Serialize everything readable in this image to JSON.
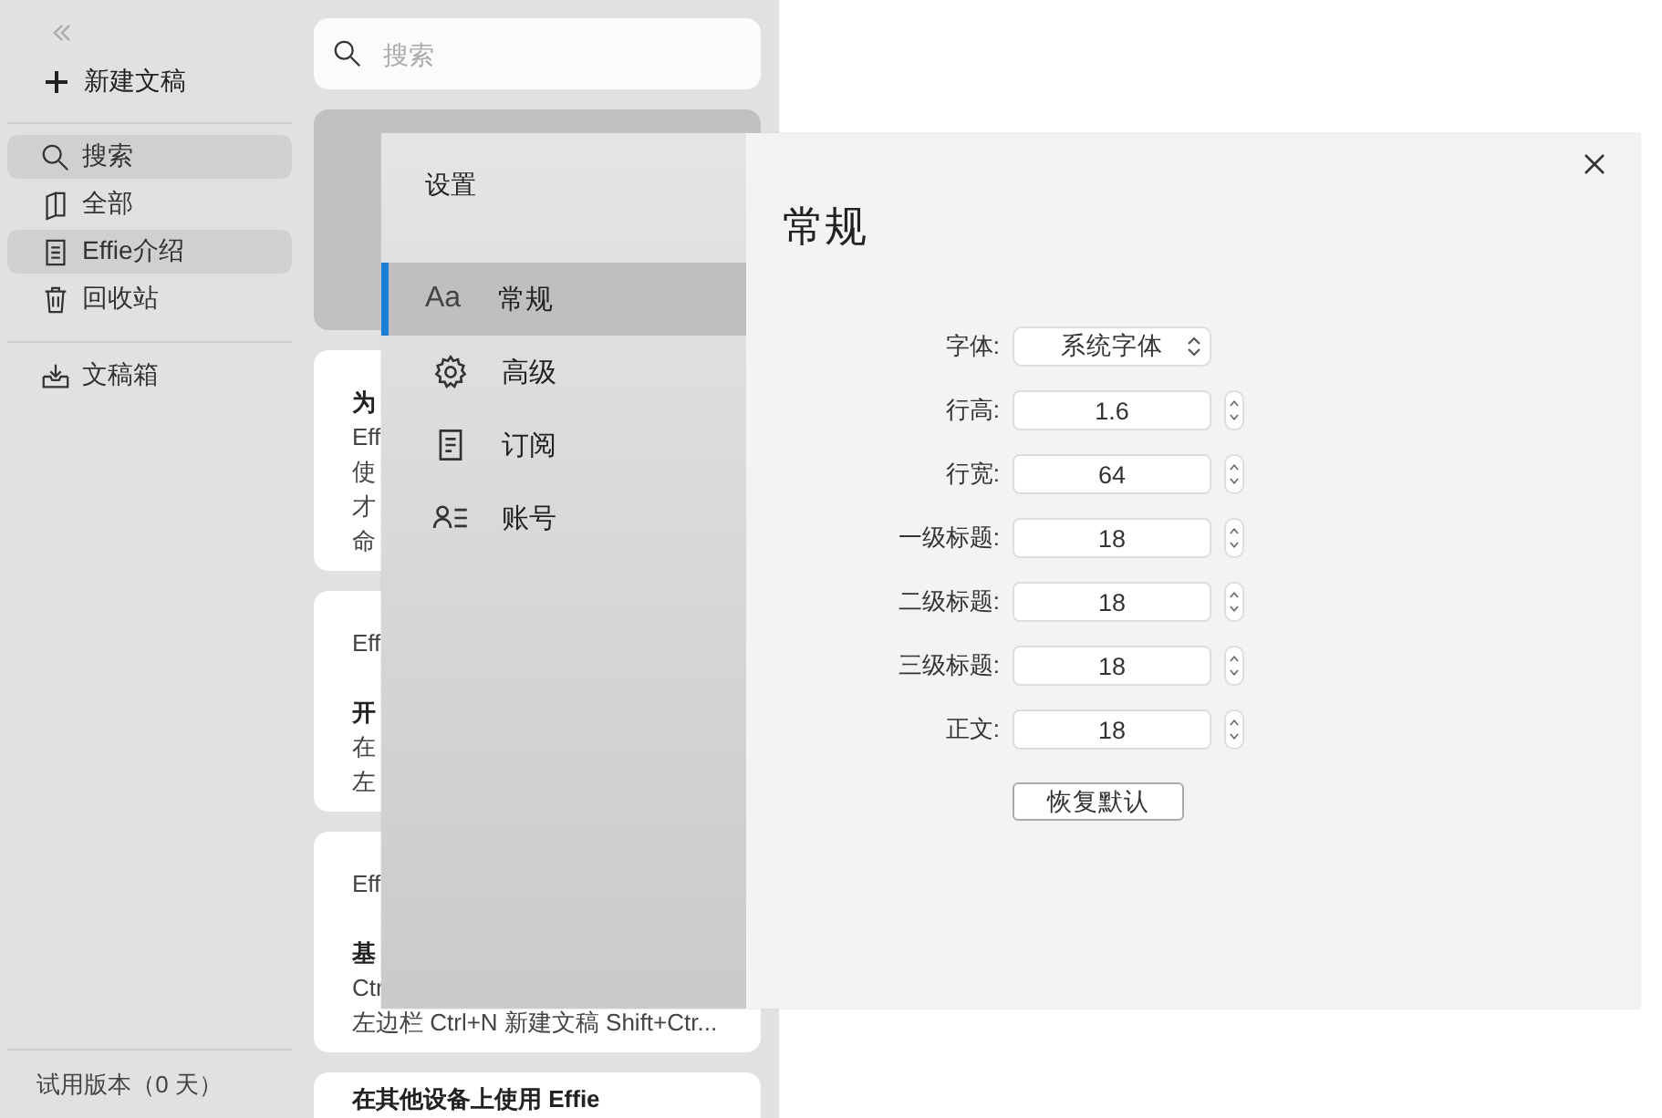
{
  "sidebar": {
    "new_doc": "新建文稿",
    "items": [
      {
        "kind": "search",
        "label": "搜索",
        "selected": true
      },
      {
        "kind": "book",
        "label": "全部",
        "selected": false
      },
      {
        "kind": "doc",
        "label": "Effie介绍",
        "selected": true
      },
      {
        "kind": "trash",
        "label": "回收站",
        "selected": false
      }
    ],
    "inbox": "文稿箱",
    "footer": "试用版本（0 天）"
  },
  "list": {
    "search": {
      "placeholder": "搜索"
    },
    "cards": [
      {
        "selected": true
      },
      {
        "selected": false,
        "lines": [
          {
            "kind": "title",
            "text": "为"
          },
          {
            "kind": "body",
            "text": "Eff"
          },
          {
            "kind": "body",
            "text": "使"
          },
          {
            "kind": "body",
            "text": "才"
          },
          {
            "kind": "body",
            "text": "命"
          }
        ]
      },
      {
        "selected": false,
        "lines": [
          {
            "kind": "body",
            "text": "Eff"
          },
          {
            "kind": "gap"
          },
          {
            "kind": "title",
            "text": "开"
          },
          {
            "kind": "body",
            "text": "在"
          },
          {
            "kind": "body",
            "text": "左"
          }
        ]
      },
      {
        "selected": false,
        "lines": [
          {
            "kind": "body",
            "text": "Eff"
          },
          {
            "kind": "gap"
          },
          {
            "kind": "title",
            "text": "基"
          },
          {
            "kind": "body",
            "text": "Ctr"
          },
          {
            "kind": "body",
            "text": "左边栏 Ctrl+N 新建文稿 Shift+Ctr..."
          }
        ]
      },
      {
        "selected": false,
        "lines": [
          {
            "kind": "title",
            "text": "在其他设备上使用 Effie"
          }
        ]
      }
    ]
  },
  "settings": {
    "title": "设置",
    "nav": [
      {
        "kind": "font",
        "glyph": "Aa",
        "label": "常规",
        "selected": true
      },
      {
        "kind": "gear",
        "label": "高级",
        "selected": false
      },
      {
        "kind": "receipt",
        "label": "订阅",
        "selected": false
      },
      {
        "kind": "account",
        "label": "账号",
        "selected": false
      }
    ],
    "heading": "常规",
    "fields": [
      {
        "kind": "select",
        "label": "字体:",
        "value": "系统字体"
      },
      {
        "kind": "stepper",
        "label": "行高:",
        "value": "1.6"
      },
      {
        "kind": "stepper",
        "label": "行宽:",
        "value": "64"
      },
      {
        "kind": "stepper",
        "label": "一级标题:",
        "value": "18"
      },
      {
        "kind": "stepper",
        "label": "二级标题:",
        "value": "18"
      },
      {
        "kind": "stepper",
        "label": "三级标题:",
        "value": "18"
      },
      {
        "kind": "stepper",
        "label": "正文:",
        "value": "18"
      }
    ],
    "reset": "恢复默认"
  }
}
